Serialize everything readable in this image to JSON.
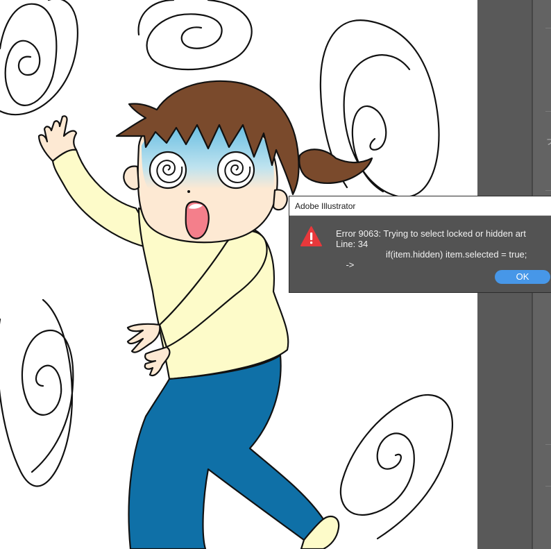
{
  "dialog": {
    "title": "Adobe Illustrator",
    "icon": "warning-icon",
    "message": {
      "line1": "Error 9063: Trying to select locked or hidden art",
      "line2": "Line: 34",
      "line3_arrow": "->",
      "line3_code": "if(item.hidden) item.selected = true;"
    },
    "ok_label": "OK"
  },
  "artwork": {
    "description_icon": "illustration",
    "colors": {
      "hair": "#7a4a2c",
      "skin": "#fde9d3",
      "shirt": "#fdfbc9",
      "pants": "#0f70a7",
      "mouth": "#f47f8b",
      "panic_blue": "#6ec4e5"
    }
  },
  "panel": {
    "glyph": "プ"
  },
  "colors": {
    "dialog_bg": "#535353",
    "accent": "#4797e8",
    "warning": "#e8383b",
    "panel_bg": "#595959"
  }
}
